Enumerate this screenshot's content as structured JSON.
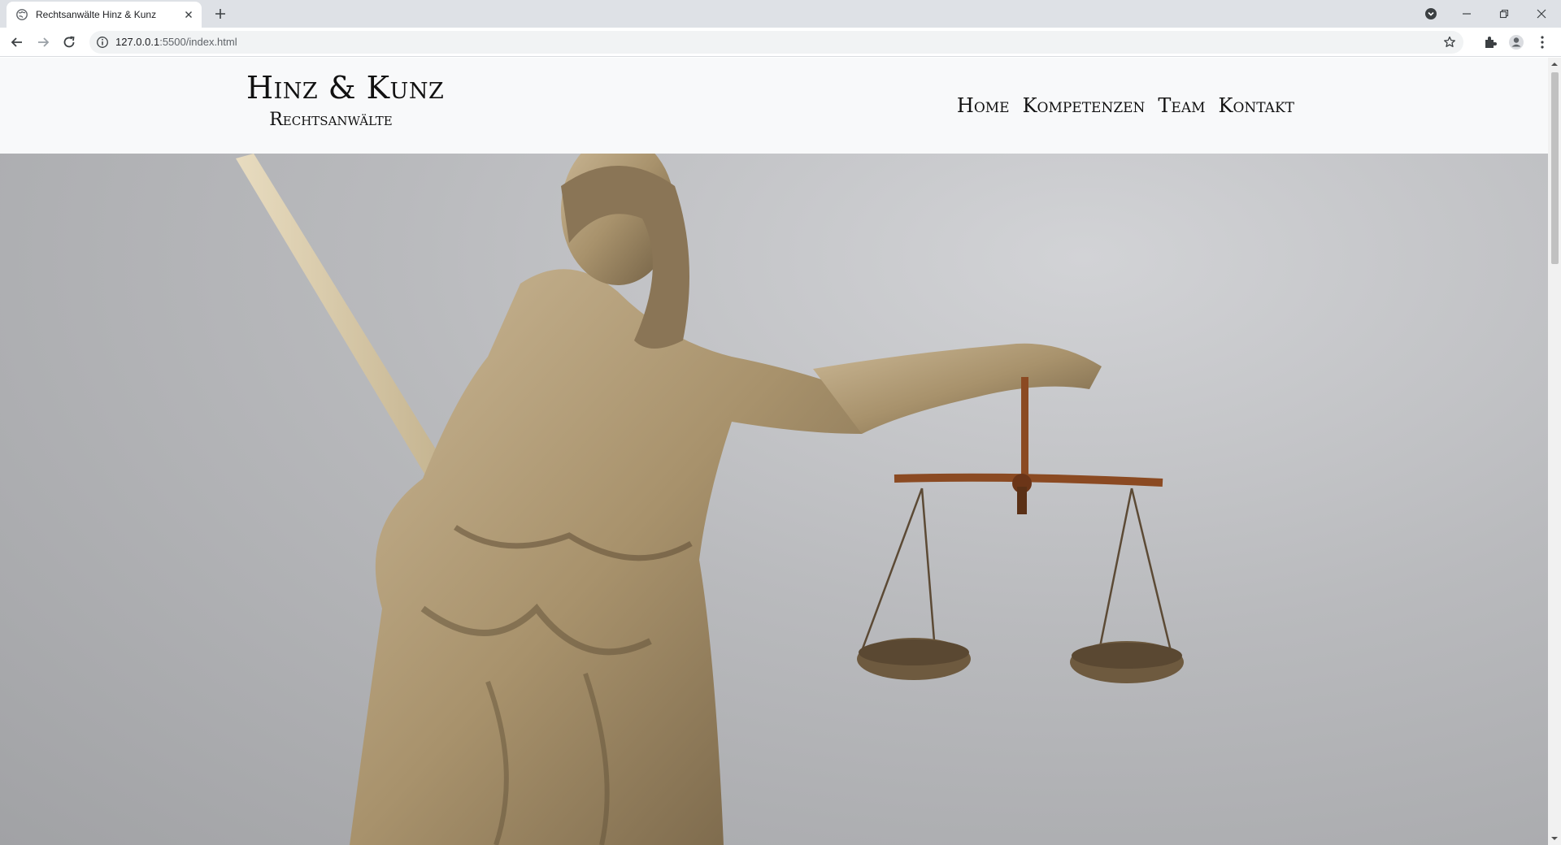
{
  "browser": {
    "tab_title": "Rechtsanwälte Hinz & Kunz",
    "url_host": "127.0.0.1",
    "url_rest": ":5500/index.html"
  },
  "site": {
    "brand_name": "Hinz & Kunz",
    "brand_tagline": "Rechtsanwälte",
    "nav": [
      {
        "label": "Home"
      },
      {
        "label": "Kompetenzen"
      },
      {
        "label": "Team"
      },
      {
        "label": "Kontakt"
      }
    ]
  },
  "hero": {
    "image": "justitia-statue-with-sword-and-scales"
  }
}
